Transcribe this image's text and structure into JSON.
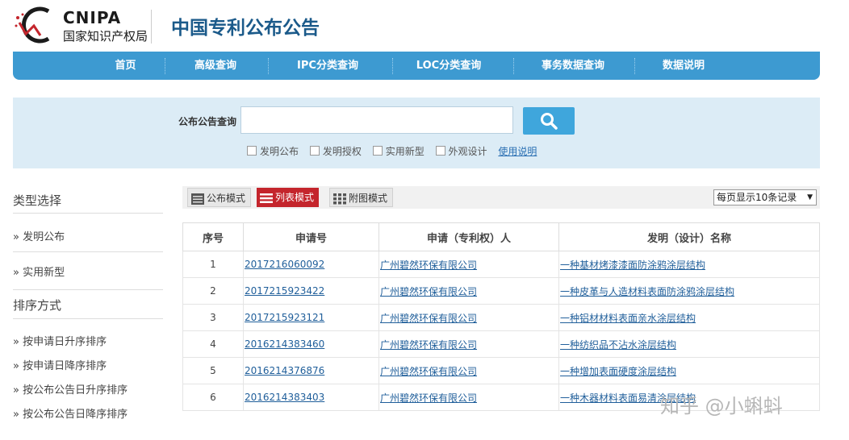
{
  "header": {
    "logo_en": "CNIPA",
    "logo_cn": "国家知识产权局",
    "site_title": "中国专利公布公告"
  },
  "nav": {
    "items": [
      {
        "label": "首页"
      },
      {
        "label": "高级查询"
      },
      {
        "label": "IPC分类查询"
      },
      {
        "label": "LOC分类查询"
      },
      {
        "label": "事务数据查询"
      },
      {
        "label": "数据说明"
      }
    ]
  },
  "search": {
    "label": "公布公告查询",
    "value": "",
    "placeholder": "",
    "options": [
      {
        "label": "发明公布",
        "checked": false
      },
      {
        "label": "发明授权",
        "checked": false
      },
      {
        "label": "实用新型",
        "checked": false
      },
      {
        "label": "外观设计",
        "checked": false
      }
    ],
    "help_link": "使用说明"
  },
  "sidebar": {
    "type_heading": "类型选择",
    "type_items": [
      "发明公布",
      "实用新型"
    ],
    "sort_heading": "排序方式",
    "sort_items": [
      "按申请日升序排序",
      "按申请日降序排序",
      "按公布公告日升序排序",
      "按公布公告日降序排序"
    ],
    "bullet": "»"
  },
  "toolbar": {
    "modes": [
      "公布模式",
      "列表模式",
      "附图模式"
    ],
    "active_mode": "列表模式",
    "per_page": "每页显示10条记录",
    "per_page_arrow": "▼"
  },
  "table": {
    "headers": [
      "序号",
      "申请号",
      "申请（专利权）人",
      "发明（设计）名称"
    ],
    "rows": [
      [
        "1",
        "2017216060092",
        "广州碧然环保有限公司",
        "一种基材烤漆漆面防涂鸦涂层结构"
      ],
      [
        "2",
        "2017215923422",
        "广州碧然环保有限公司",
        "一种皮革与人造材料表面防涂鸦涂层结构"
      ],
      [
        "3",
        "2017215923121",
        "广州碧然环保有限公司",
        "一种铝材材料表面亲水涂层结构"
      ],
      [
        "4",
        "2016214383460",
        "广州碧然环保有限公司",
        "一种纺织品不沾水涂层结构"
      ],
      [
        "5",
        "2016214376876",
        "广州碧然环保有限公司",
        "一种增加表面硬度涂层结构"
      ],
      [
        "6",
        "2016214383403",
        "广州碧然环保有限公司",
        "一种木器材料表面易清涂层结构"
      ]
    ]
  },
  "watermark": "知乎 @小蝌蚪",
  "colors": {
    "nav_bg": "#3d9ad1",
    "search_panel_bg": "#dcecf6",
    "search_button": "#3fa6dc",
    "active_mode_bg": "#c4252c",
    "link": "#1f5e9a",
    "title": "#1b5a8a"
  },
  "icons": {
    "logo": "cnipa-logo-icon",
    "search": "search-icon",
    "publication_mode": "list-lines-icon",
    "list_mode": "list-icon",
    "figure_mode": "grid-icon"
  }
}
